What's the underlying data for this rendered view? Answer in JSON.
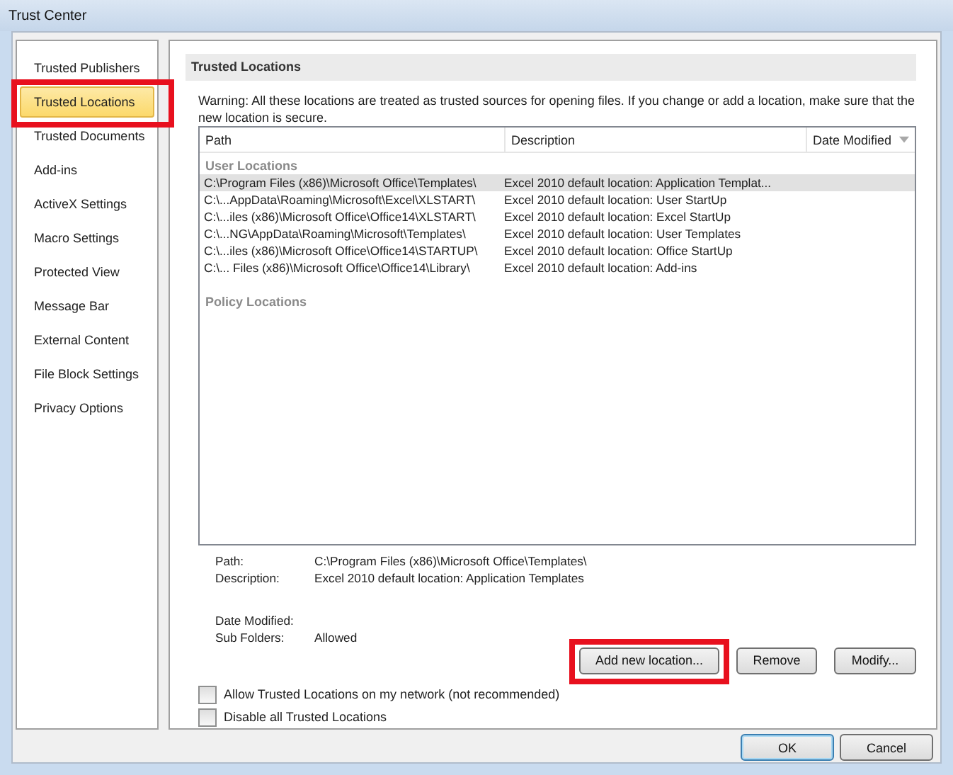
{
  "window": {
    "title": "Trust Center"
  },
  "sidebar": {
    "items": [
      {
        "label": "Trusted Publishers",
        "selected": false,
        "highlighted": false
      },
      {
        "label": "Trusted Locations",
        "selected": true,
        "highlighted": true
      },
      {
        "label": "Trusted Documents",
        "selected": false,
        "highlighted": false
      },
      {
        "label": "Add-ins",
        "selected": false,
        "highlighted": false
      },
      {
        "label": "ActiveX Settings",
        "selected": false,
        "highlighted": false
      },
      {
        "label": "Macro Settings",
        "selected": false,
        "highlighted": false
      },
      {
        "label": "Protected View",
        "selected": false,
        "highlighted": false
      },
      {
        "label": "Message Bar",
        "selected": false,
        "highlighted": false
      },
      {
        "label": "External Content",
        "selected": false,
        "highlighted": false
      },
      {
        "label": "File Block Settings",
        "selected": false,
        "highlighted": false
      },
      {
        "label": "Privacy Options",
        "selected": false,
        "highlighted": false
      }
    ]
  },
  "section": {
    "title": "Trusted Locations",
    "warning": "Warning: All these locations are treated as trusted sources for opening files.  If you change or add a location, make sure that the new location is secure."
  },
  "table": {
    "columns": [
      "Path",
      "Description",
      "Date Modified"
    ],
    "groups": [
      {
        "label": "User Locations",
        "rows": [
          {
            "path": "C:\\Program Files (x86)\\Microsoft Office\\Templates\\",
            "description": "Excel 2010 default location: Application Templat...",
            "selected": true
          },
          {
            "path": "C:\\...AppData\\Roaming\\Microsoft\\Excel\\XLSTART\\",
            "description": "Excel 2010 default location: User StartUp",
            "selected": false
          },
          {
            "path": "C:\\...iles (x86)\\Microsoft Office\\Office14\\XLSTART\\",
            "description": "Excel 2010 default location: Excel StartUp",
            "selected": false
          },
          {
            "path": "C:\\...NG\\AppData\\Roaming\\Microsoft\\Templates\\",
            "description": "Excel 2010 default location: User Templates",
            "selected": false
          },
          {
            "path": "C:\\...iles (x86)\\Microsoft Office\\Office14\\STARTUP\\",
            "description": "Excel 2010 default location: Office StartUp",
            "selected": false
          },
          {
            "path": "C:\\... Files (x86)\\Microsoft Office\\Office14\\Library\\",
            "description": "Excel 2010 default location: Add-ins",
            "selected": false
          }
        ]
      },
      {
        "label": "Policy Locations"
      }
    ]
  },
  "details": [
    {
      "label": "Path:",
      "value": "C:\\Program Files (x86)\\Microsoft Office\\Templates\\"
    },
    {
      "label": "Description:",
      "value": "Excel 2010 default location: Application Templates"
    },
    {
      "label": "Date Modified:"
    },
    {
      "label": "Sub Folders:",
      "value": "Allowed"
    }
  ],
  "actions": [
    {
      "label": "Add new location...",
      "highlighted": true
    },
    {
      "label": "Remove",
      "highlighted": false
    },
    {
      "label": "Modify...",
      "highlighted": false
    }
  ],
  "options": [
    {
      "label": "Allow Trusted Locations on my network (not recommended)",
      "checked": false
    },
    {
      "label": "Disable all Trusted Locations",
      "checked": false
    }
  ],
  "footer_buttons": [
    {
      "label": "OK",
      "default": true
    },
    {
      "label": "Cancel",
      "default": false
    }
  ]
}
